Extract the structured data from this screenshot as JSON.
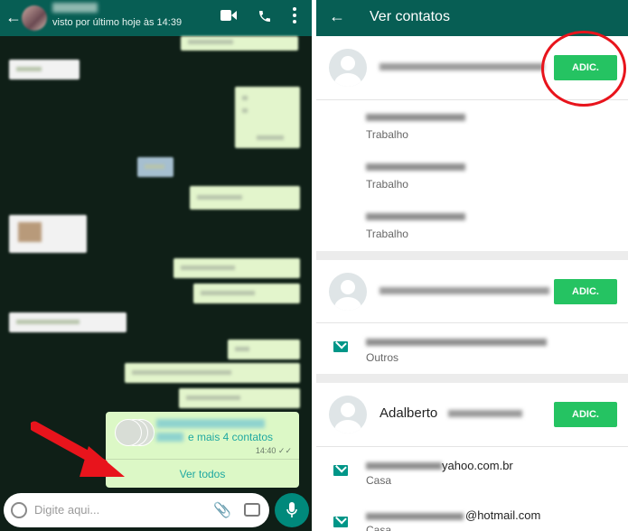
{
  "chat": {
    "status": "visto por último hoje às 14:39",
    "icons": [
      "back-arrow-icon",
      "video-call-icon",
      "phone-icon",
      "more-vert-icon"
    ],
    "contact_card": {
      "more_label": "e mais 4 contatos",
      "time": "14:40",
      "view_all": "Ver todos"
    },
    "input_placeholder": "Digite aqui...",
    "accent": "#075e54",
    "bubble_color": "#dcf8c6"
  },
  "contacts": {
    "title": "Ver contatos",
    "add_label": "ADIC.",
    "entries": [
      {
        "rows": [
          {
            "label": "Trabalho"
          },
          {
            "label": "Trabalho"
          },
          {
            "label": "Trabalho"
          }
        ]
      },
      {
        "rows": [
          {
            "label": "Outros"
          }
        ]
      },
      {
        "name": "Adalberto",
        "rows": [
          {
            "text": "yahoo.com.br",
            "label": "Casa"
          },
          {
            "text": "@hotmail.com",
            "label": "Casa"
          }
        ]
      }
    ],
    "add_button_color": "#25c362",
    "highlight_color": "#e8141c"
  }
}
